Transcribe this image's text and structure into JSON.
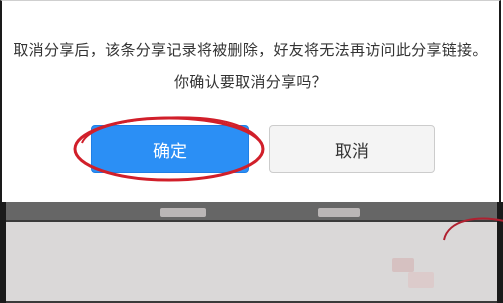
{
  "dialog": {
    "message_line1": "取消分享后，该条分享记录将被删除，好友将无法再访问此分享链接。",
    "message_line2": "你确认要取消分享吗？"
  },
  "buttons": {
    "confirm_label": "确定",
    "cancel_label": "取消"
  },
  "colors": {
    "confirm_bg": "#2b8ff5",
    "cancel_bg": "#f4f4f4",
    "highlight": "#d11f2a"
  }
}
